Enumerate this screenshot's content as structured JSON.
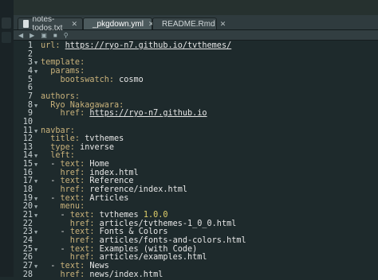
{
  "tabs": [
    {
      "label": "notes-todos.txt",
      "icon": "text-file-icon",
      "active": false
    },
    {
      "label": "_pkgdown.yml",
      "icon": "yaml-file-icon",
      "active": true
    },
    {
      "label": "README.Rmd",
      "icon": "rmd-file-icon",
      "active": false
    }
  ],
  "lines": [
    {
      "n": "1",
      "fold": false,
      "segs": [
        [
          "k",
          "url: "
        ],
        [
          "u",
          "https://ryo-n7.github.io/tvthemes/"
        ]
      ]
    },
    {
      "n": "2",
      "fold": false,
      "segs": []
    },
    {
      "n": "3",
      "fold": true,
      "segs": [
        [
          "k",
          "template:"
        ]
      ]
    },
    {
      "n": "4",
      "fold": true,
      "segs": [
        [
          "k",
          "  params:"
        ]
      ]
    },
    {
      "n": "5",
      "fold": false,
      "segs": [
        [
          "k",
          "    bootswatch: "
        ],
        [
          "t",
          "cosmo"
        ]
      ]
    },
    {
      "n": "6",
      "fold": false,
      "segs": []
    },
    {
      "n": "7",
      "fold": false,
      "segs": [
        [
          "k",
          "authors:"
        ]
      ]
    },
    {
      "n": "8",
      "fold": true,
      "segs": [
        [
          "k",
          "  Ryo Nakagawara:"
        ]
      ]
    },
    {
      "n": "9",
      "fold": false,
      "segs": [
        [
          "k",
          "    href: "
        ],
        [
          "u",
          "https://ryo-n7.github.io"
        ]
      ]
    },
    {
      "n": "10",
      "fold": false,
      "segs": []
    },
    {
      "n": "11",
      "fold": true,
      "segs": [
        [
          "k",
          "navbar:"
        ]
      ]
    },
    {
      "n": "12",
      "fold": false,
      "segs": [
        [
          "k",
          "  title: "
        ],
        [
          "t",
          "tvthemes"
        ]
      ]
    },
    {
      "n": "13",
      "fold": false,
      "segs": [
        [
          "k",
          "  type: "
        ],
        [
          "t",
          "inverse"
        ]
      ]
    },
    {
      "n": "14",
      "fold": true,
      "segs": [
        [
          "k",
          "  left:"
        ]
      ]
    },
    {
      "n": "15",
      "fold": true,
      "segs": [
        [
          "t",
          "  - "
        ],
        [
          "k",
          "text: "
        ],
        [
          "t",
          "Home"
        ]
      ]
    },
    {
      "n": "16",
      "fold": false,
      "segs": [
        [
          "k",
          "    href: "
        ],
        [
          "t",
          "index.html"
        ]
      ]
    },
    {
      "n": "17",
      "fold": true,
      "segs": [
        [
          "t",
          "  - "
        ],
        [
          "k",
          "text: "
        ],
        [
          "t",
          "Reference"
        ]
      ]
    },
    {
      "n": "18",
      "fold": false,
      "segs": [
        [
          "k",
          "    href: "
        ],
        [
          "t",
          "reference/index.html"
        ]
      ]
    },
    {
      "n": "19",
      "fold": true,
      "segs": [
        [
          "t",
          "  - "
        ],
        [
          "k",
          "text: "
        ],
        [
          "t",
          "Articles"
        ]
      ]
    },
    {
      "n": "20",
      "fold": true,
      "segs": [
        [
          "k",
          "    menu:"
        ]
      ]
    },
    {
      "n": "21",
      "fold": true,
      "segs": [
        [
          "t",
          "    - "
        ],
        [
          "k",
          "text: "
        ],
        [
          "t",
          "tvthemes "
        ],
        [
          "n",
          "1.0.0"
        ]
      ]
    },
    {
      "n": "22",
      "fold": false,
      "segs": [
        [
          "k",
          "      href: "
        ],
        [
          "t",
          "articles/tvthemes-1_0_0.html"
        ]
      ]
    },
    {
      "n": "23",
      "fold": true,
      "segs": [
        [
          "t",
          "    - "
        ],
        [
          "k",
          "text: "
        ],
        [
          "t",
          "Fonts & Colors"
        ]
      ]
    },
    {
      "n": "24",
      "fold": false,
      "segs": [
        [
          "k",
          "      href: "
        ],
        [
          "t",
          "articles/fonts-and-colors.html"
        ]
      ]
    },
    {
      "n": "25",
      "fold": true,
      "segs": [
        [
          "t",
          "    - "
        ],
        [
          "k",
          "text: "
        ],
        [
          "t",
          "Examples (with Code)"
        ]
      ]
    },
    {
      "n": "26",
      "fold": false,
      "segs": [
        [
          "k",
          "      href: "
        ],
        [
          "t",
          "articles/examples.html"
        ]
      ]
    },
    {
      "n": "27",
      "fold": true,
      "segs": [
        [
          "t",
          "  - "
        ],
        [
          "k",
          "text: "
        ],
        [
          "t",
          "News"
        ]
      ]
    },
    {
      "n": "28",
      "fold": false,
      "segs": [
        [
          "k",
          "    href: "
        ],
        [
          "t",
          "news/index.html"
        ]
      ]
    }
  ]
}
